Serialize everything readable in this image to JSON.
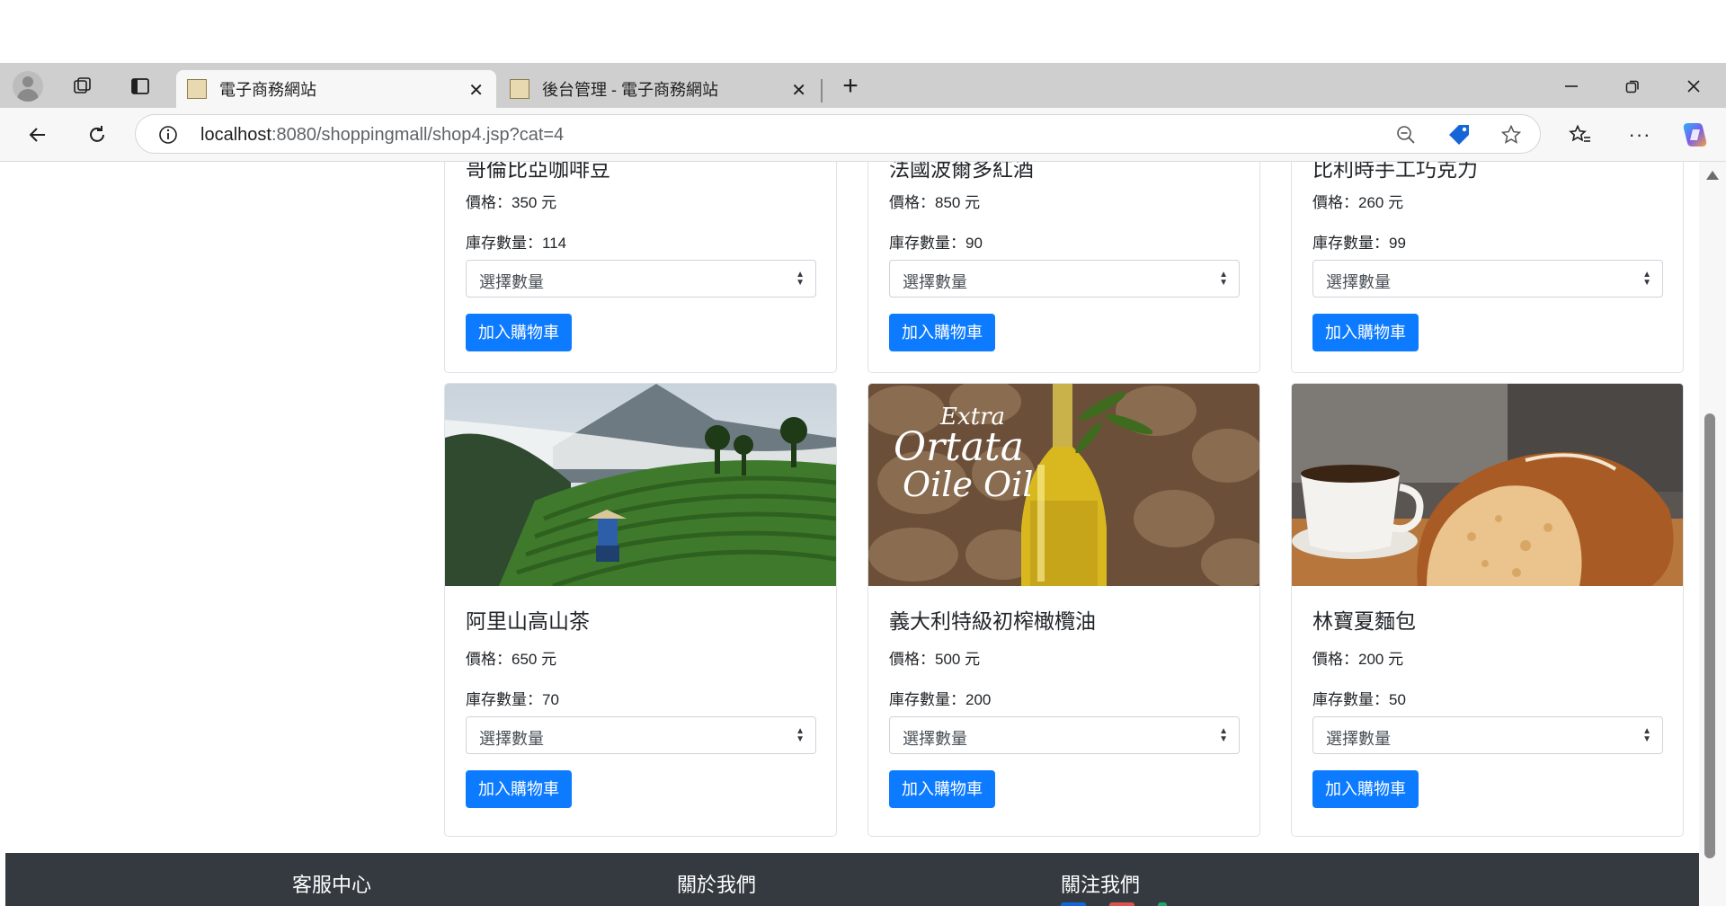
{
  "browser": {
    "tabs": [
      {
        "title": "電子商務網站",
        "active": true
      },
      {
        "title": "後台管理 - 電子商務網站",
        "active": false
      }
    ],
    "url_host": "localhost",
    "url_path": ":8080/shoppingmall/shop4.jsp?cat=4",
    "icons": [
      "profile-icon",
      "workspaces-icon",
      "tab-actions-icon",
      "close-tab-icon",
      "new-tab-icon",
      "minimize-icon",
      "restore-icon",
      "close-window-icon",
      "back-icon",
      "refresh-icon",
      "site-info-icon",
      "zoom-out-icon",
      "shopping-tag-icon",
      "favorite-star-icon",
      "favorites-icon",
      "more-icon",
      "copilot-icon"
    ]
  },
  "products_top": [
    {
      "name": "哥倫比亞咖啡豆",
      "price": "價格：350 元",
      "stock": "庫存數量：114",
      "select_placeholder": "選擇數量",
      "button": "加入購物車"
    },
    {
      "name": "法國波爾多紅酒",
      "price": "價格：850 元",
      "stock": "庫存數量：90",
      "select_placeholder": "選擇數量",
      "button": "加入購物車"
    },
    {
      "name": "比利時手工巧克力",
      "price": "價格：260 元",
      "stock": "庫存數量：99",
      "select_placeholder": "選擇數量",
      "button": "加入購物車"
    }
  ],
  "products_bottom": [
    {
      "name": "阿里山高山茶",
      "price": "價格：650 元",
      "stock": "庫存數量：70",
      "select_placeholder": "選擇數量",
      "button": "加入購物車",
      "image": "tea-plantation-photo"
    },
    {
      "name": "義大利特級初榨橄欖油",
      "price": "價格：500 元",
      "stock": "庫存數量：200",
      "select_placeholder": "選擇數量",
      "button": "加入購物車",
      "image": "olive-oil-bottle-photo",
      "image_text_1": "Extra",
      "image_text_2": "Ortata",
      "image_text_3": "Oile Oil"
    },
    {
      "name": "林寶夏麵包",
      "price": "價格：200 元",
      "stock": "庫存數量：50",
      "select_placeholder": "選擇數量",
      "button": "加入購物車",
      "image": "bread-coffee-photo"
    }
  ],
  "footer": {
    "service": "客服中心",
    "about": "關於我們",
    "follow": "關注我們"
  },
  "colors": {
    "primary": "#0d7bff",
    "footer": "#343a40"
  }
}
